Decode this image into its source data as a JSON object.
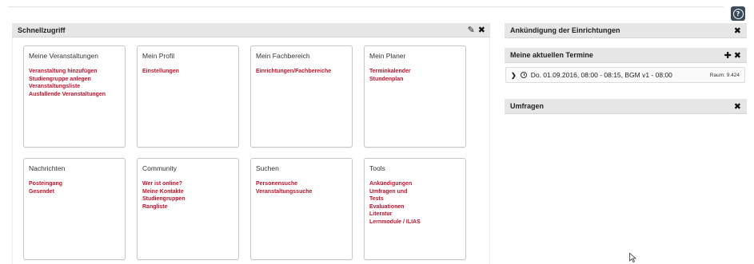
{
  "header": {
    "help_label": "?"
  },
  "quick_access": {
    "title": "Schnellzugriff",
    "tiles": [
      {
        "title": "Meine Veranstaltungen",
        "links": [
          "Veranstaltung hinzufügen",
          "Studiengruppe anlegen",
          "Veranstaltungsliste",
          "Ausfallende Veranstaltungen"
        ]
      },
      {
        "title": "Mein Profil",
        "links": [
          "Einstellungen"
        ]
      },
      {
        "title": "Mein Fachbereich",
        "links": [
          "Einrichtungen/Fachbereiche"
        ]
      },
      {
        "title": "Mein Planer",
        "links": [
          "Terminkalender",
          "Stundenplan"
        ]
      },
      {
        "title": "Nachrichten",
        "links": [
          "Posteingang",
          "Gesendet"
        ]
      },
      {
        "title": "Community",
        "links": [
          "Wer ist online?",
          "Meine Kontakte",
          "Studiengruppen",
          "Rangliste"
        ]
      },
      {
        "title": "Suchen",
        "links": [
          "Personensuche",
          "Veranstaltungssuche"
        ]
      },
      {
        "title": "Tools",
        "links": [
          "Ankündigungen",
          "Umfragen und",
          "Tests",
          "Evaluationen",
          "Literatur",
          "Lernmodule / ILIAS"
        ]
      }
    ]
  },
  "sidebar": {
    "announcements_title": "Ankündigung der Einrichtungen",
    "appointments_title": "Meine aktuellen Termine",
    "appointment": {
      "text": "Do. 01.09.2016, 08:00 - 08:15, BGM v1 - 08:00",
      "room": "Raum: 9.424"
    },
    "surveys_title": "Umfragen"
  },
  "colors": {
    "link": "#c0142e",
    "header_bg": "#e6e6e6",
    "help_bg": "#3c4a5a"
  }
}
